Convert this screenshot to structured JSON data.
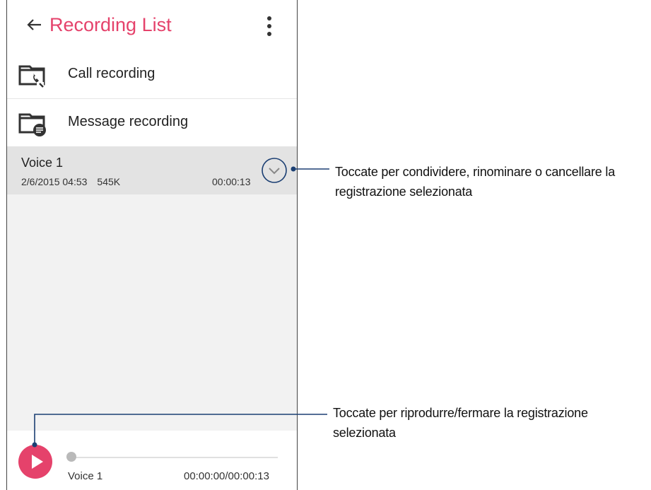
{
  "header": {
    "title": "Recording List",
    "back_icon": "arrow-left-icon",
    "menu_icon": "more-vertical-icon"
  },
  "folders": [
    {
      "label": "Call recording",
      "icon": "call-folder-icon"
    },
    {
      "label": "Message recording",
      "icon": "message-folder-icon"
    }
  ],
  "recording": {
    "name": "Voice 1",
    "date": "2/6/2015 04:53",
    "size": "545K",
    "duration": "00:00:13",
    "expand_icon": "chevron-down-icon"
  },
  "player": {
    "name": "Voice 1",
    "time": "00:00:00/00:00:13",
    "progress": 0,
    "play_icon": "play-icon"
  },
  "callouts": {
    "expand": "Toccate per condividere, rinominare o cancellare la registrazione selezionata",
    "play": "Toccate per riprodurre/fermare la registrazione selezionata"
  },
  "colors": {
    "accent": "#e5426b",
    "callout_line": "#1b3f73",
    "selected_row": "#e3e3e3",
    "background": "#f2f2f2"
  }
}
